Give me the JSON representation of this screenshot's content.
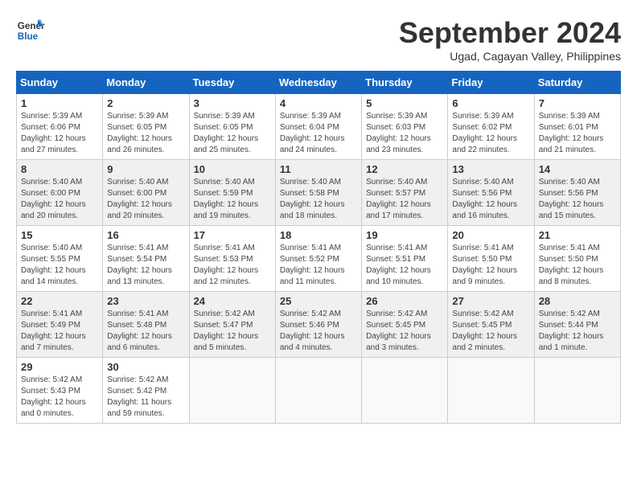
{
  "header": {
    "logo_line1": "General",
    "logo_line2": "Blue",
    "month_title": "September 2024",
    "subtitle": "Ugad, Cagayan Valley, Philippines"
  },
  "calendar": {
    "weekdays": [
      "Sunday",
      "Monday",
      "Tuesday",
      "Wednesday",
      "Thursday",
      "Friday",
      "Saturday"
    ],
    "weeks": [
      [
        {
          "day": "",
          "info": ""
        },
        {
          "day": "",
          "info": ""
        },
        {
          "day": "",
          "info": ""
        },
        {
          "day": "",
          "info": ""
        },
        {
          "day": "",
          "info": ""
        },
        {
          "day": "",
          "info": ""
        },
        {
          "day": "",
          "info": ""
        }
      ]
    ],
    "days": [
      {
        "date": "1",
        "sunrise": "5:39 AM",
        "sunset": "6:06 PM",
        "daylight": "12 hours and 27 minutes."
      },
      {
        "date": "2",
        "sunrise": "5:39 AM",
        "sunset": "6:05 PM",
        "daylight": "12 hours and 26 minutes."
      },
      {
        "date": "3",
        "sunrise": "5:39 AM",
        "sunset": "6:05 PM",
        "daylight": "12 hours and 25 minutes."
      },
      {
        "date": "4",
        "sunrise": "5:39 AM",
        "sunset": "6:04 PM",
        "daylight": "12 hours and 24 minutes."
      },
      {
        "date": "5",
        "sunrise": "5:39 AM",
        "sunset": "6:03 PM",
        "daylight": "12 hours and 23 minutes."
      },
      {
        "date": "6",
        "sunrise": "5:39 AM",
        "sunset": "6:02 PM",
        "daylight": "12 hours and 22 minutes."
      },
      {
        "date": "7",
        "sunrise": "5:39 AM",
        "sunset": "6:01 PM",
        "daylight": "12 hours and 21 minutes."
      },
      {
        "date": "8",
        "sunrise": "5:40 AM",
        "sunset": "6:00 PM",
        "daylight": "12 hours and 20 minutes."
      },
      {
        "date": "9",
        "sunrise": "5:40 AM",
        "sunset": "6:00 PM",
        "daylight": "12 hours and 20 minutes."
      },
      {
        "date": "10",
        "sunrise": "5:40 AM",
        "sunset": "5:59 PM",
        "daylight": "12 hours and 19 minutes."
      },
      {
        "date": "11",
        "sunrise": "5:40 AM",
        "sunset": "5:58 PM",
        "daylight": "12 hours and 18 minutes."
      },
      {
        "date": "12",
        "sunrise": "5:40 AM",
        "sunset": "5:57 PM",
        "daylight": "12 hours and 17 minutes."
      },
      {
        "date": "13",
        "sunrise": "5:40 AM",
        "sunset": "5:56 PM",
        "daylight": "12 hours and 16 minutes."
      },
      {
        "date": "14",
        "sunrise": "5:40 AM",
        "sunset": "5:56 PM",
        "daylight": "12 hours and 15 minutes."
      },
      {
        "date": "15",
        "sunrise": "5:40 AM",
        "sunset": "5:55 PM",
        "daylight": "12 hours and 14 minutes."
      },
      {
        "date": "16",
        "sunrise": "5:41 AM",
        "sunset": "5:54 PM",
        "daylight": "12 hours and 13 minutes."
      },
      {
        "date": "17",
        "sunrise": "5:41 AM",
        "sunset": "5:53 PM",
        "daylight": "12 hours and 12 minutes."
      },
      {
        "date": "18",
        "sunrise": "5:41 AM",
        "sunset": "5:52 PM",
        "daylight": "12 hours and 11 minutes."
      },
      {
        "date": "19",
        "sunrise": "5:41 AM",
        "sunset": "5:51 PM",
        "daylight": "12 hours and 10 minutes."
      },
      {
        "date": "20",
        "sunrise": "5:41 AM",
        "sunset": "5:50 PM",
        "daylight": "12 hours and 9 minutes."
      },
      {
        "date": "21",
        "sunrise": "5:41 AM",
        "sunset": "5:50 PM",
        "daylight": "12 hours and 8 minutes."
      },
      {
        "date": "22",
        "sunrise": "5:41 AM",
        "sunset": "5:49 PM",
        "daylight": "12 hours and 7 minutes."
      },
      {
        "date": "23",
        "sunrise": "5:41 AM",
        "sunset": "5:48 PM",
        "daylight": "12 hours and 6 minutes."
      },
      {
        "date": "24",
        "sunrise": "5:42 AM",
        "sunset": "5:47 PM",
        "daylight": "12 hours and 5 minutes."
      },
      {
        "date": "25",
        "sunrise": "5:42 AM",
        "sunset": "5:46 PM",
        "daylight": "12 hours and 4 minutes."
      },
      {
        "date": "26",
        "sunrise": "5:42 AM",
        "sunset": "5:45 PM",
        "daylight": "12 hours and 3 minutes."
      },
      {
        "date": "27",
        "sunrise": "5:42 AM",
        "sunset": "5:45 PM",
        "daylight": "12 hours and 2 minutes."
      },
      {
        "date": "28",
        "sunrise": "5:42 AM",
        "sunset": "5:44 PM",
        "daylight": "12 hours and 1 minute."
      },
      {
        "date": "29",
        "sunrise": "5:42 AM",
        "sunset": "5:43 PM",
        "daylight": "12 hours and 0 minutes."
      },
      {
        "date": "30",
        "sunrise": "5:42 AM",
        "sunset": "5:42 PM",
        "daylight": "11 hours and 59 minutes."
      }
    ],
    "labels": {
      "sunrise": "Sunrise:",
      "sunset": "Sunset:",
      "daylight": "Daylight:"
    }
  }
}
